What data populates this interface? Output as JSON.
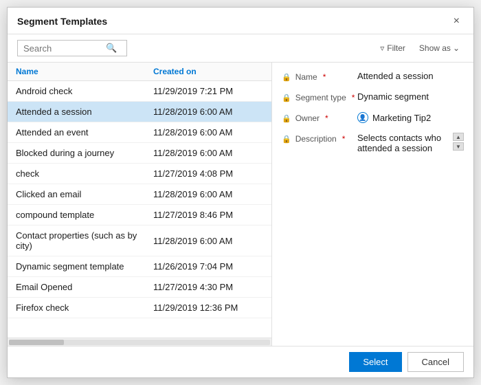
{
  "dialog": {
    "title": "Segment Templates",
    "close_label": "×"
  },
  "toolbar": {
    "search_placeholder": "Search",
    "search_icon": "🔍",
    "filter_label": "Filter",
    "filter_icon": "▽",
    "show_as_label": "Show as",
    "show_as_icon": "∨"
  },
  "list": {
    "col_name": "Name",
    "col_created": "Created on",
    "rows": [
      {
        "name": "Android check",
        "date": "11/29/2019 7:21 PM",
        "selected": false
      },
      {
        "name": "Attended a session",
        "date": "11/28/2019 6:00 AM",
        "selected": true
      },
      {
        "name": "Attended an event",
        "date": "11/28/2019 6:00 AM",
        "selected": false
      },
      {
        "name": "Blocked during a journey",
        "date": "11/28/2019 6:00 AM",
        "selected": false
      },
      {
        "name": "check",
        "date": "11/27/2019 4:08 PM",
        "selected": false
      },
      {
        "name": "Clicked an email",
        "date": "11/28/2019 6:00 AM",
        "selected": false
      },
      {
        "name": "compound template",
        "date": "11/27/2019 8:46 PM",
        "selected": false
      },
      {
        "name": "Contact properties (such as by city)",
        "date": "11/28/2019 6:00 AM",
        "selected": false
      },
      {
        "name": "Dynamic segment template",
        "date": "11/26/2019 7:04 PM",
        "selected": false
      },
      {
        "name": "Email Opened",
        "date": "11/27/2019 4:30 PM",
        "selected": false
      },
      {
        "name": "Firefox check",
        "date": "11/29/2019 12:36 PM",
        "selected": false
      }
    ]
  },
  "detail": {
    "name_label": "Name",
    "name_value": "Attended a session",
    "segment_type_label": "Segment type",
    "segment_type_value": "Dynamic segment",
    "owner_label": "Owner",
    "owner_value": "Marketing Tip2",
    "description_label": "Description",
    "description_value": "Selects contacts who attended a session"
  },
  "footer": {
    "select_label": "Select",
    "cancel_label": "Cancel"
  }
}
